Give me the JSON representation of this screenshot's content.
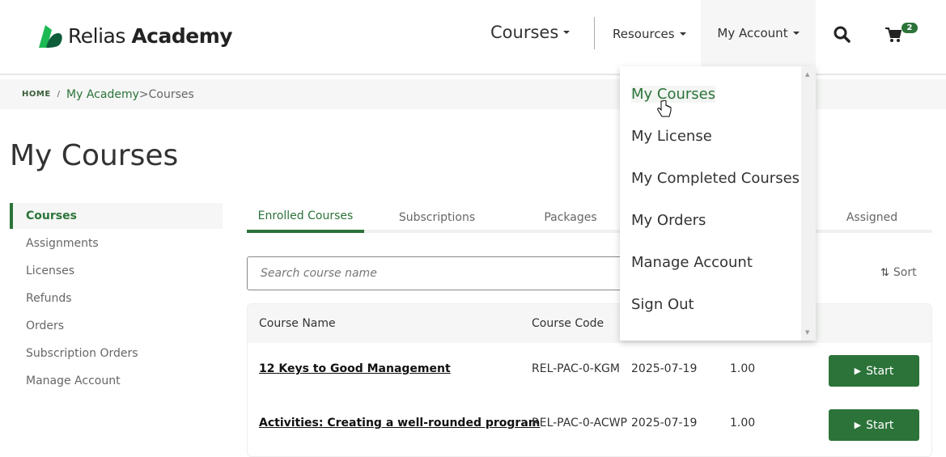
{
  "header": {
    "logo": {
      "word1": "Relias",
      "word2": "Academy"
    },
    "nav": {
      "courses": "Courses",
      "resources": "Resources",
      "my_account": "My Account"
    },
    "cart_count": "2",
    "colors": {
      "brand_green": "#2b7339",
      "logo_light": "#1db954",
      "logo_dark": "#0d5c3a"
    }
  },
  "breadcrumb": {
    "home": "HOME",
    "sep": "/",
    "academy": "My Academy",
    ">": ">",
    "current": "Courses"
  },
  "page_title": "My Courses",
  "sidebar": {
    "items": [
      {
        "label": "Courses",
        "active": true
      },
      {
        "label": "Assignments"
      },
      {
        "label": "Licenses"
      },
      {
        "label": "Refunds"
      },
      {
        "label": "Orders"
      },
      {
        "label": "Subscription Orders"
      },
      {
        "label": "Manage Account"
      }
    ]
  },
  "tabs": [
    {
      "label": "Enrolled Courses",
      "active": true
    },
    {
      "label": "Subscriptions"
    },
    {
      "label": "Packages"
    },
    {
      "label": "Assigned"
    }
  ],
  "search": {
    "placeholder": "Search course name"
  },
  "sort_label": "Sort",
  "table": {
    "headers": [
      "Course Name",
      "Course Code"
    ],
    "rows": [
      {
        "name": "12 Keys to Good Management",
        "code": "REL-PAC-0-KGM",
        "date": "2025-07-19",
        "hours": "1.00",
        "action": "Start"
      },
      {
        "name": "Activities: Creating a well-rounded program",
        "code": "REL-PAC-0-ACWP",
        "date": "2025-07-19",
        "hours": "1.00",
        "action": "Start"
      }
    ]
  },
  "dropdown": {
    "items": [
      "My Courses",
      "My License",
      "My Completed Courses",
      "My Orders",
      "Manage Account",
      "Sign Out"
    ],
    "hovered": "My Courses"
  }
}
